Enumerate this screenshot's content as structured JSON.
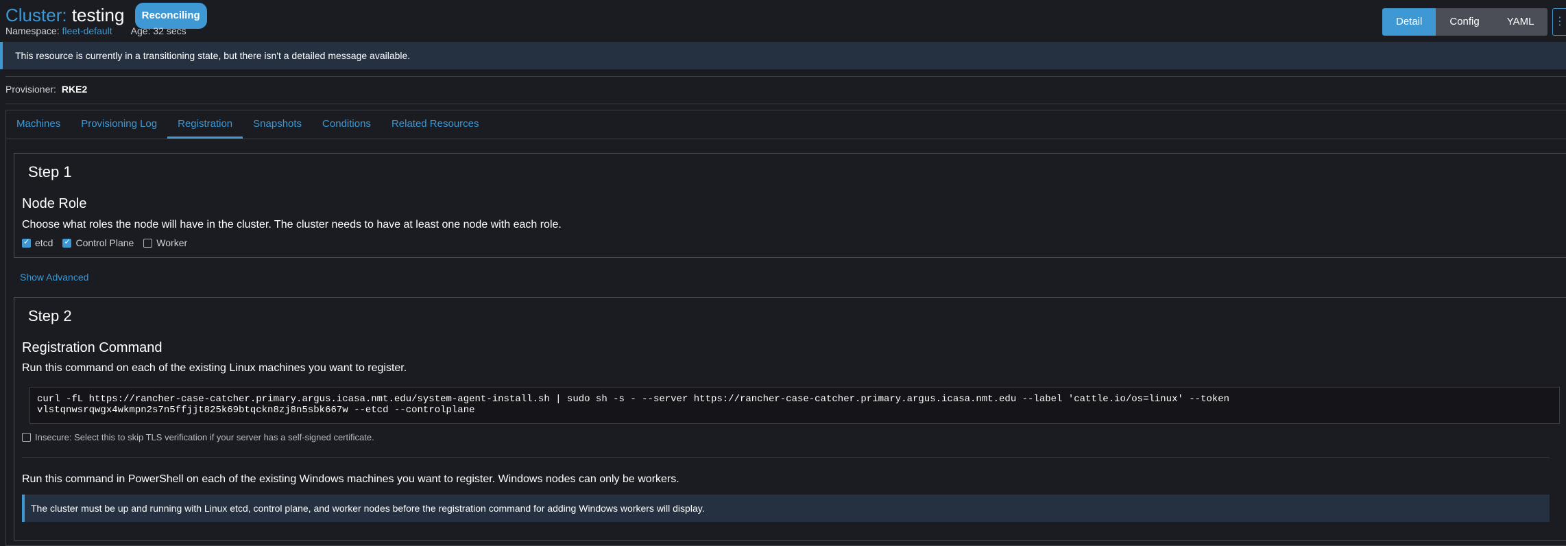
{
  "header": {
    "kind": "Cluster:",
    "name": "testing",
    "state": "Reconciling",
    "namespace_label": "Namespace:",
    "namespace": "fleet-default",
    "age_label": "Age:",
    "age": "32 secs",
    "modes": [
      "Detail",
      "Config",
      "YAML"
    ],
    "more_icon": "⋮"
  },
  "banner": "This resource is currently in a transitioning state, but there isn't a detailed message available.",
  "provisioner": {
    "label": "Provisioner:",
    "value": "RKE2"
  },
  "tabs": [
    "Machines",
    "Provisioning Log",
    "Registration",
    "Snapshots",
    "Conditions",
    "Related Resources"
  ],
  "active_tab": "Registration",
  "step1": {
    "title": "Step 1",
    "subtitle": "Node Role",
    "description": "Choose what roles the node will have in the cluster. The cluster needs to have at least one node with each role.",
    "roles": [
      {
        "label": "etcd",
        "checked": true
      },
      {
        "label": "Control Plane",
        "checked": true
      },
      {
        "label": "Worker",
        "checked": false
      }
    ]
  },
  "show_advanced": "Show Advanced",
  "step2": {
    "title": "Step 2",
    "subtitle": "Registration Command",
    "description": "Run this command on each of the existing Linux machines you want to register.",
    "command_line1": "curl -fL https://rancher-case-catcher.primary.argus.icasa.nmt.edu/system-agent-install.sh | sudo sh -s - --server https://rancher-case-catcher.primary.argus.icasa.nmt.edu --label 'cattle.io/os=linux' --token",
    "command_line2": "vlstqnwsrqwgx4wkmpn2s7n5ffjjt825k69btqckn8zj8n5sbk667w --etcd --controlplane",
    "insecure_label": "Insecure: Select this to skip TLS verification if your server has a self-signed certificate.",
    "windows_description": "Run this command in PowerShell on each of the existing Windows machines you want to register. Windows nodes can only be workers.",
    "windows_note": "The cluster must be up and running with Linux etcd, control plane, and worker nodes before the registration command for adding Windows workers will display."
  },
  "colors": {
    "accent": "#3d98d3",
    "background": "#1b1c21",
    "banner": "#253040"
  }
}
